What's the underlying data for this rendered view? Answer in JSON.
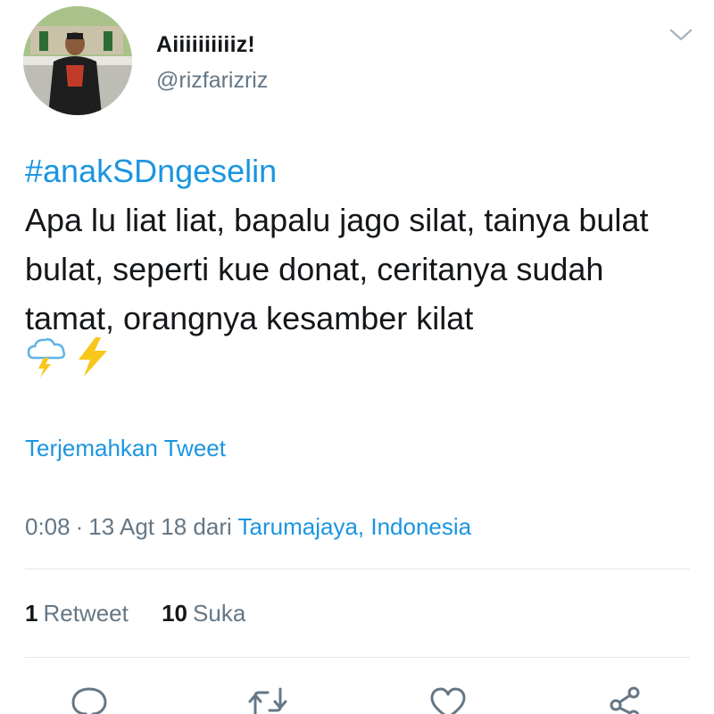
{
  "user": {
    "display_name": "Aiiiiiiiiiiz!",
    "handle": "@rizfarizriz",
    "avatar_icon": "profile-photo"
  },
  "menu": {
    "icon": "chevron-down-icon"
  },
  "tweet": {
    "hashtag": "#anakSDngeselin",
    "text": "Apa lu liat liat, bapalu jago silat, tainya bulat bulat, seperti kue donat, ceritanya sudah tamat, orangnya kesamber kilat",
    "emojis": [
      "cloud-with-lightning",
      "high-voltage"
    ]
  },
  "translate_label": "Terjemahkan Tweet",
  "meta": {
    "time": "0:08",
    "separator": "·",
    "date": "13 Agt 18",
    "from_label": "dari",
    "location": "Tarumajaya, Indonesia"
  },
  "stats": {
    "retweets_count": "1",
    "retweets_label": "Retweet",
    "likes_count": "10",
    "likes_label": "Suka"
  },
  "actions": [
    "reply-icon",
    "retweet-icon",
    "like-icon",
    "share-icon"
  ],
  "colors": {
    "link": "#1b95e0",
    "secondary_text": "#657786",
    "divider": "#e1e8ed",
    "emoji_lightning": "#f7c71a",
    "emoji_cloud": "#5fb3e6"
  }
}
